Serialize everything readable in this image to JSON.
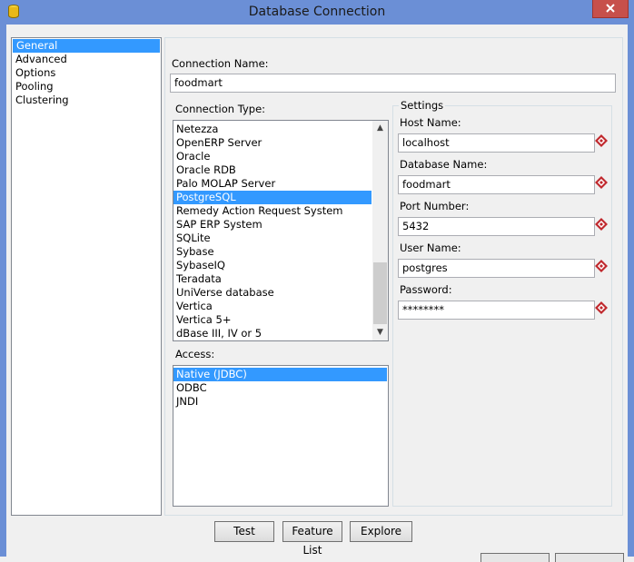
{
  "window": {
    "title": "Database Connection"
  },
  "nav": {
    "items": [
      {
        "label": "General",
        "selected": true
      },
      {
        "label": "Advanced",
        "selected": false
      },
      {
        "label": "Options",
        "selected": false
      },
      {
        "label": "Pooling",
        "selected": false
      },
      {
        "label": "Clustering",
        "selected": false
      }
    ]
  },
  "connection_name": {
    "label": "Connection Name:",
    "value": "foodmart"
  },
  "connection_type": {
    "label": "Connection Type:",
    "items": [
      "Netezza",
      "OpenERP Server",
      "Oracle",
      "Oracle RDB",
      "Palo MOLAP Server",
      "PostgreSQL",
      "Remedy Action Request System",
      "SAP ERP System",
      "SQLite",
      "Sybase",
      "SybaseIQ",
      "Teradata",
      "UniVerse database",
      "Vertica",
      "Vertica 5+",
      "dBase III, IV or 5"
    ],
    "selected": "PostgreSQL"
  },
  "access": {
    "label": "Access:",
    "items": [
      "Native (JDBC)",
      "ODBC",
      "JNDI"
    ],
    "selected": "Native (JDBC)"
  },
  "settings": {
    "legend": "Settings",
    "host": {
      "label": "Host Name:",
      "value": "localhost"
    },
    "database": {
      "label": "Database Name:",
      "value": "foodmart"
    },
    "port": {
      "label": "Port Number:",
      "value": "5432"
    },
    "user": {
      "label": "User Name:",
      "value": "postgres"
    },
    "password": {
      "label": "Password:",
      "value": "********"
    }
  },
  "buttons": {
    "test": "Test",
    "feature_list": "Feature List",
    "explore": "Explore"
  },
  "colors": {
    "titlebar": "#6b8fd6",
    "selection": "#3399ff",
    "required_icon": "#c0282d"
  }
}
